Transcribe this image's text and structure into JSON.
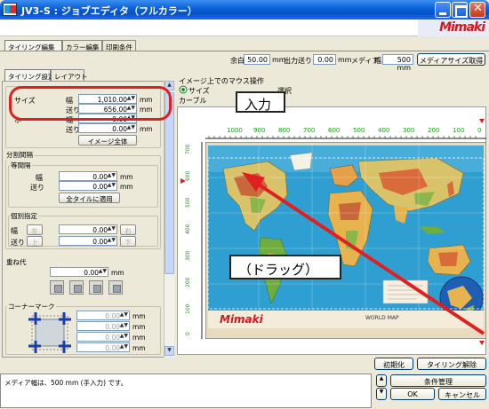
{
  "window": {
    "title": "JV3-S : ジョブエディタ（フルカラー）"
  },
  "brand": {
    "logo_text": "Mimaki"
  },
  "main_tabs": [
    "タイリング編集",
    "カラー編集",
    "印刷条件"
  ],
  "topbar": {
    "margin_label": "余白",
    "margin_value": "50.00",
    "margin_unit": "mm",
    "output_label": "出力",
    "feed_label": "送り",
    "feed_value": "0.00",
    "feed_unit": "mm",
    "media_label": "メディア",
    "width_label": "幅",
    "width_value": "500 mm",
    "media_size_button": "メディアサイズ取得"
  },
  "sub_tabs": [
    "タイリング設定",
    "レイアウト"
  ],
  "size_group": {
    "title": "",
    "size_label": "サイズ",
    "width_label": "幅",
    "width_value": "1,010.00",
    "feed_label": "送り",
    "feed_value": "656.00",
    "unit": "mm",
    "row3_label": "ホ",
    "row3_suffix": "ー",
    "row3_width_label": "幅",
    "row3_width_value": "0.00",
    "row3_feed_label": "送り",
    "row3_feed_value": "0.00",
    "image_all_button": "イメージ全体"
  },
  "split_group": {
    "title": "分割間隔",
    "equal_title": "等間隔",
    "width_label": "幅",
    "width_value": "0.00",
    "feed_label": "送り",
    "feed_value": "0.00",
    "unit": "mm",
    "apply_all_button": "全タイルに適用",
    "individual_title": "個別指定",
    "ind_width_label": "幅",
    "ind_left_label": "左",
    "ind_width_value": "0.00",
    "ind_right_label": "右",
    "ind_feed_label": "送り",
    "ind_top_label": "上",
    "ind_feed_value": "0.00",
    "ind_bottom_label": "下"
  },
  "overlap_group": {
    "title": "重ね代",
    "value": "0.00",
    "unit": "mm"
  },
  "corner_group": {
    "title": "コーナーマーク",
    "values": [
      "0.00",
      "0.00",
      "0.00",
      "0.00"
    ],
    "unit": "mm"
  },
  "preview": {
    "mouse_op_title": "イメージ上でのマウス操作",
    "option_size": "サイズ",
    "option_select": "選択",
    "curve_label": "カーブル",
    "ruler_labels": [
      "1000",
      "900",
      "800",
      "700",
      "600",
      "500",
      "400",
      "300",
      "200",
      "100",
      "0"
    ],
    "ruler_v_labels": [
      "700",
      "600",
      "500",
      "400",
      "300",
      "200",
      "100",
      "0"
    ],
    "map_footer": "WORLD MAP",
    "map_logo": "Mimaki"
  },
  "annotations": {
    "input_callout": "入力",
    "drag_callout": "（ドラッグ）"
  },
  "preview_buttons": {
    "init_button": "初期化",
    "tiling_clear_button": "タイリング解除"
  },
  "status": {
    "message": "メディア幅は、500 mm (手入力) です。"
  },
  "bottom_buttons": {
    "conditions_button": "条件管理",
    "ok_button": "OK",
    "cancel_button": "キャンセル"
  },
  "colors": {
    "title_bar": "#0a5fd8",
    "brand_red": "#d7161e",
    "annotation_red": "#e02020",
    "window_bg": "#ece9d8"
  }
}
